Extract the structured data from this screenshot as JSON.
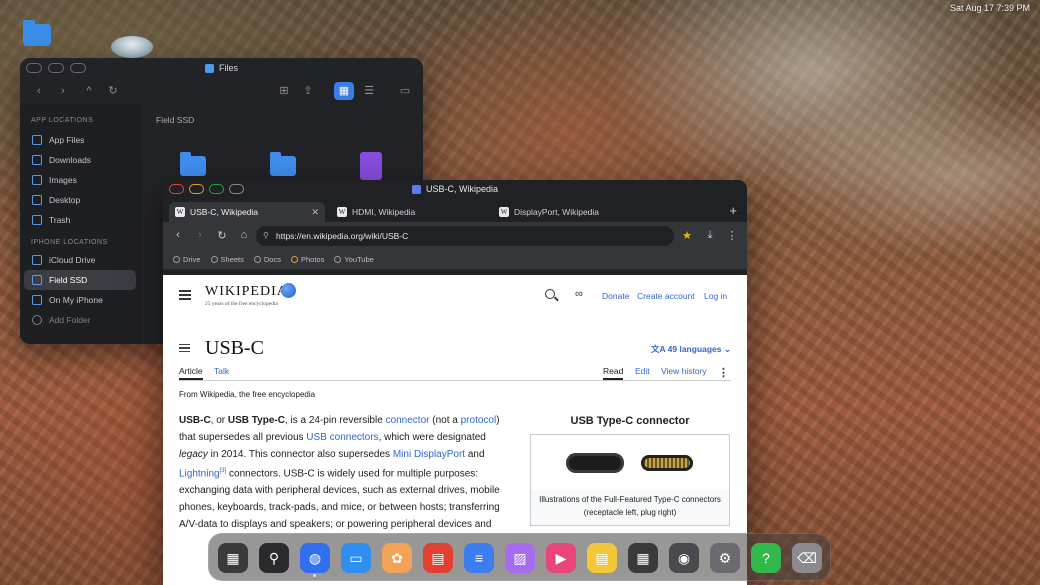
{
  "desktop": {
    "status": "Sat Aug 17 7:39 PM"
  },
  "files": {
    "title": "Files",
    "section_app": "APP LOCATIONS",
    "section_iphone": "IPHONE LOCATIONS",
    "app_items": [
      "App Files",
      "Downloads",
      "Images",
      "Desktop",
      "Trash"
    ],
    "iphone_items": [
      "iCloud Drive",
      "Field SSD",
      "On My iPhone"
    ],
    "add_folder": "Add Folder",
    "breadcrumb": "Field SSD",
    "selected": "Field SSD"
  },
  "browser": {
    "window_title": "USB-C, Wikipedia",
    "tabs": [
      {
        "label": "USB-C, Wikipedia",
        "fav": "W"
      },
      {
        "label": "HDMI, Wikipedia",
        "fav": "W"
      },
      {
        "label": "DisplayPort, Wikipedia",
        "fav": "W"
      }
    ],
    "url": "https://en.wikipedia.org/wiki/USB-C",
    "bookmarks": [
      "Drive",
      "Sheets",
      "Docs",
      "Photos",
      "YouTube"
    ]
  },
  "wiki": {
    "logo": "WIKIPEDIA",
    "tagline": "25 years of the free encyclopedia",
    "donate": "Donate",
    "create_account": "Create account",
    "login": "Log in",
    "title": "USB-C",
    "languages": "49 languages",
    "tab_article": "Article",
    "tab_talk": "Talk",
    "tab_read": "Read",
    "tab_edit": "Edit",
    "tab_history": "View history",
    "from": "From Wikipedia, the free encyclopedia",
    "infobox_title": "USB Type-C connector",
    "infobox_caption": "Illustrations of the Full-Featured Type-C connectors (receptacle left, plug right)",
    "para": {
      "t1": "USB-C",
      "t2": ", or ",
      "t3": "USB Type-C",
      "t4": ", is a 24-pin reversible ",
      "l1": "connector",
      "t5": " (not a ",
      "l2": "protocol",
      "t6": ") that supersedes all previous ",
      "l3": "USB connectors",
      "t7": ", which were designated ",
      "t8": "legacy",
      "t9": " in 2014. This connector also supersedes ",
      "l4": "Mini DisplayPort",
      "t10": " and ",
      "l5": "Lightning",
      "sup": "[3]",
      "t11": " connectors. USB-C is widely used for multiple purposes: exchanging data with peripheral devices, such as external drives, mobile phones, keyboards, track-pads, and mice, or between hosts; transferring A/V-data to displays and speakers; or powering peripheral devices and"
    }
  },
  "dock": {
    "apps": [
      {
        "name": "launchpad",
        "color": "#3a3a3c"
      },
      {
        "name": "finder-search",
        "color": "#2a2a2e"
      },
      {
        "name": "browser",
        "color": "#2f6ff0"
      },
      {
        "name": "files",
        "color": "#2f8ff0"
      },
      {
        "name": "photos",
        "color": "#f3a356"
      },
      {
        "name": "pdf",
        "color": "#e2402f"
      },
      {
        "name": "docs",
        "color": "#3c7ef0"
      },
      {
        "name": "gallery",
        "color": "#a66bf0"
      },
      {
        "name": "video",
        "color": "#e8457a"
      },
      {
        "name": "notes",
        "color": "#f2c73a"
      },
      {
        "name": "calculator",
        "color": "#3a3a3c"
      },
      {
        "name": "camera",
        "color": "#4a4a4e"
      },
      {
        "name": "settings",
        "color": "#6a6a70"
      },
      {
        "name": "help",
        "color": "#33b84c"
      },
      {
        "name": "trash",
        "color": "#8a8a90"
      }
    ]
  }
}
